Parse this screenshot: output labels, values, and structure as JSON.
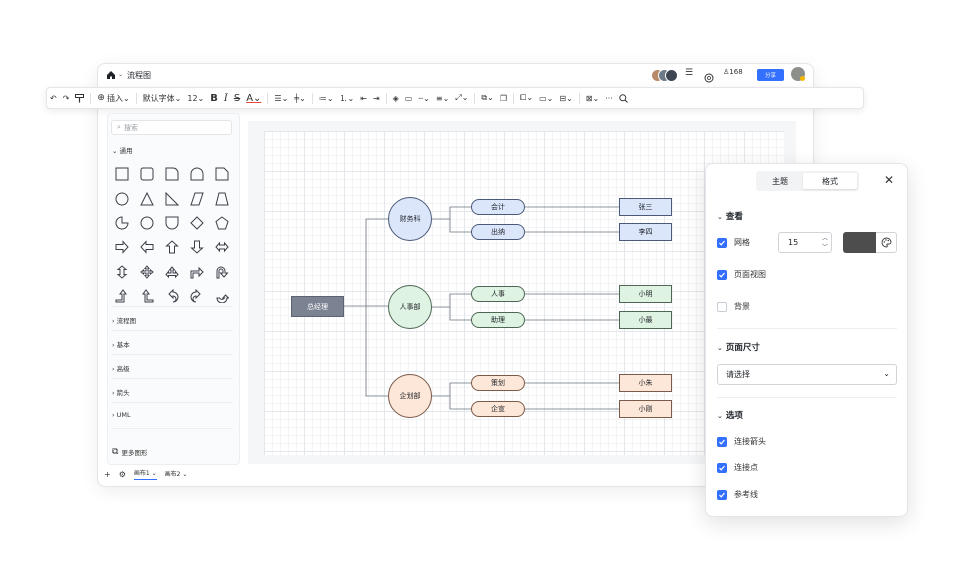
{
  "header": {
    "title": "流程图",
    "viewer_count": "168",
    "share_label": "分享"
  },
  "toolbar": {
    "insert_label": "插入",
    "font_label": "默认字体",
    "font_size": "12",
    "bold": "B",
    "italic": "I",
    "strike": "S",
    "font_color": "A"
  },
  "sidebar": {
    "search_placeholder": "搜索",
    "general_section": "通用",
    "categories": [
      "流程图",
      "基本",
      "高级",
      "箭头",
      "UML"
    ],
    "more_shapes": "更多图形"
  },
  "canvas_tabs": [
    "画布1",
    "画布2"
  ],
  "diagram": {
    "root": "总经理",
    "departments": [
      {
        "name": "财务科",
        "roles": [
          {
            "role": "会计",
            "person": "张三"
          },
          {
            "role": "出纳",
            "person": "李四"
          }
        ]
      },
      {
        "name": "人事部",
        "roles": [
          {
            "role": "人事",
            "person": "小明"
          },
          {
            "role": "助理",
            "person": "小最"
          }
        ]
      },
      {
        "name": "企划部",
        "roles": [
          {
            "role": "策划",
            "person": "小朱"
          },
          {
            "role": "企宣",
            "person": "小刚"
          }
        ]
      }
    ]
  },
  "panel": {
    "tab_theme": "主题",
    "tab_format": "格式",
    "view_section": "查看",
    "grid_label": "网格",
    "grid_size": "15",
    "page_view_label": "页面视图",
    "background_label": "背景",
    "page_size_section": "页面尺寸",
    "page_size_select": "请选择",
    "options_section": "选项",
    "connect_arrow_label": "连接箭头",
    "connect_point_label": "连接点",
    "guide_line_label": "参考线",
    "grid_checked": true,
    "page_view_checked": true,
    "background_checked": false,
    "connect_arrow_checked": true,
    "connect_point_checked": true,
    "guide_line_checked": true
  },
  "colors": {
    "accent": "#3370ff",
    "finance_fill": "#dbe6fb",
    "finance_stroke": "#4a5a78",
    "hr_fill": "#def3e2",
    "hr_stroke": "#4d6655",
    "plan_fill": "#fde7d8",
    "plan_stroke": "#7a5a48",
    "root_fill": "#7b8292",
    "grid_swatch": "#4d4d4d"
  }
}
